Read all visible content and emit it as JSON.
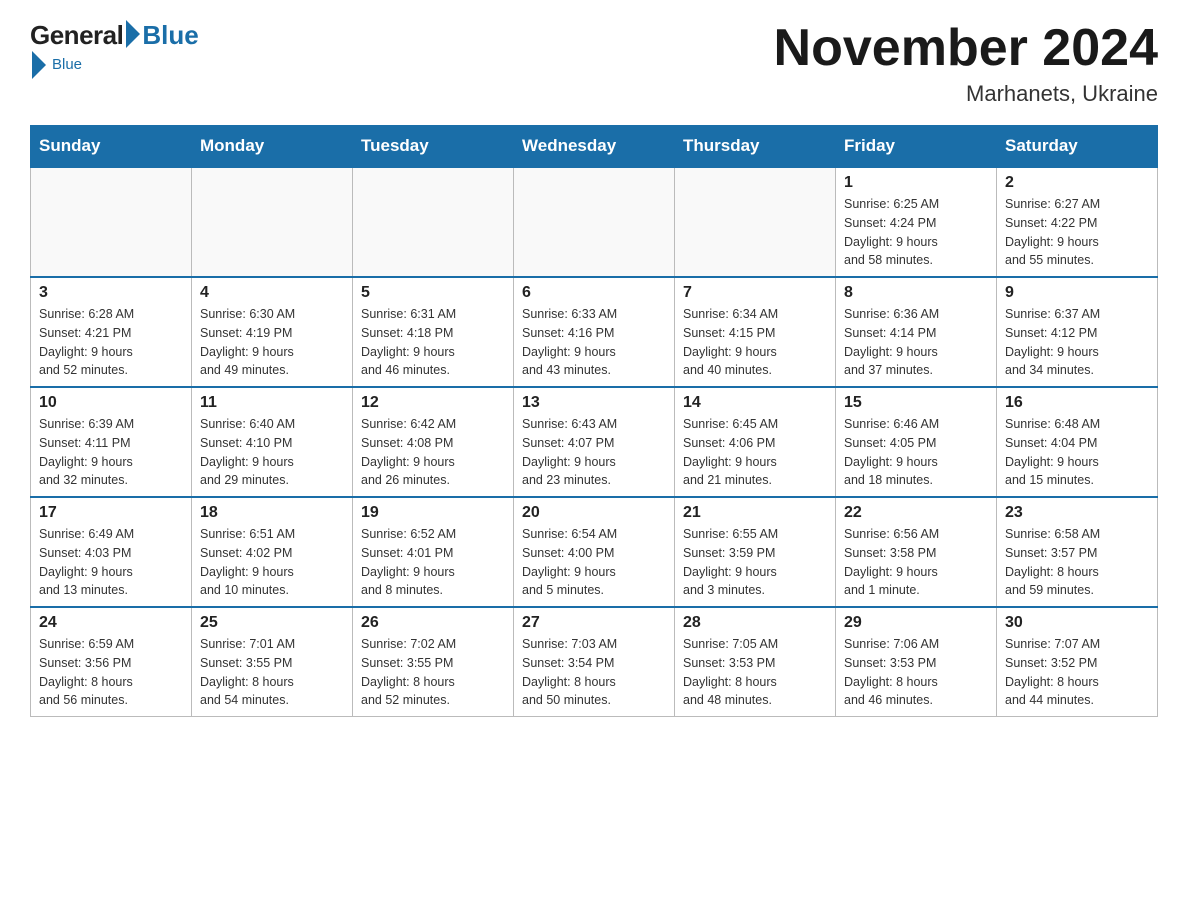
{
  "logo": {
    "general": "General",
    "blue": "Blue"
  },
  "header": {
    "month": "November 2024",
    "location": "Marhanets, Ukraine"
  },
  "weekdays": [
    "Sunday",
    "Monday",
    "Tuesday",
    "Wednesday",
    "Thursday",
    "Friday",
    "Saturday"
  ],
  "weeks": [
    [
      {
        "day": "",
        "info": ""
      },
      {
        "day": "",
        "info": ""
      },
      {
        "day": "",
        "info": ""
      },
      {
        "day": "",
        "info": ""
      },
      {
        "day": "",
        "info": ""
      },
      {
        "day": "1",
        "info": "Sunrise: 6:25 AM\nSunset: 4:24 PM\nDaylight: 9 hours\nand 58 minutes."
      },
      {
        "day": "2",
        "info": "Sunrise: 6:27 AM\nSunset: 4:22 PM\nDaylight: 9 hours\nand 55 minutes."
      }
    ],
    [
      {
        "day": "3",
        "info": "Sunrise: 6:28 AM\nSunset: 4:21 PM\nDaylight: 9 hours\nand 52 minutes."
      },
      {
        "day": "4",
        "info": "Sunrise: 6:30 AM\nSunset: 4:19 PM\nDaylight: 9 hours\nand 49 minutes."
      },
      {
        "day": "5",
        "info": "Sunrise: 6:31 AM\nSunset: 4:18 PM\nDaylight: 9 hours\nand 46 minutes."
      },
      {
        "day": "6",
        "info": "Sunrise: 6:33 AM\nSunset: 4:16 PM\nDaylight: 9 hours\nand 43 minutes."
      },
      {
        "day": "7",
        "info": "Sunrise: 6:34 AM\nSunset: 4:15 PM\nDaylight: 9 hours\nand 40 minutes."
      },
      {
        "day": "8",
        "info": "Sunrise: 6:36 AM\nSunset: 4:14 PM\nDaylight: 9 hours\nand 37 minutes."
      },
      {
        "day": "9",
        "info": "Sunrise: 6:37 AM\nSunset: 4:12 PM\nDaylight: 9 hours\nand 34 minutes."
      }
    ],
    [
      {
        "day": "10",
        "info": "Sunrise: 6:39 AM\nSunset: 4:11 PM\nDaylight: 9 hours\nand 32 minutes."
      },
      {
        "day": "11",
        "info": "Sunrise: 6:40 AM\nSunset: 4:10 PM\nDaylight: 9 hours\nand 29 minutes."
      },
      {
        "day": "12",
        "info": "Sunrise: 6:42 AM\nSunset: 4:08 PM\nDaylight: 9 hours\nand 26 minutes."
      },
      {
        "day": "13",
        "info": "Sunrise: 6:43 AM\nSunset: 4:07 PM\nDaylight: 9 hours\nand 23 minutes."
      },
      {
        "day": "14",
        "info": "Sunrise: 6:45 AM\nSunset: 4:06 PM\nDaylight: 9 hours\nand 21 minutes."
      },
      {
        "day": "15",
        "info": "Sunrise: 6:46 AM\nSunset: 4:05 PM\nDaylight: 9 hours\nand 18 minutes."
      },
      {
        "day": "16",
        "info": "Sunrise: 6:48 AM\nSunset: 4:04 PM\nDaylight: 9 hours\nand 15 minutes."
      }
    ],
    [
      {
        "day": "17",
        "info": "Sunrise: 6:49 AM\nSunset: 4:03 PM\nDaylight: 9 hours\nand 13 minutes."
      },
      {
        "day": "18",
        "info": "Sunrise: 6:51 AM\nSunset: 4:02 PM\nDaylight: 9 hours\nand 10 minutes."
      },
      {
        "day": "19",
        "info": "Sunrise: 6:52 AM\nSunset: 4:01 PM\nDaylight: 9 hours\nand 8 minutes."
      },
      {
        "day": "20",
        "info": "Sunrise: 6:54 AM\nSunset: 4:00 PM\nDaylight: 9 hours\nand 5 minutes."
      },
      {
        "day": "21",
        "info": "Sunrise: 6:55 AM\nSunset: 3:59 PM\nDaylight: 9 hours\nand 3 minutes."
      },
      {
        "day": "22",
        "info": "Sunrise: 6:56 AM\nSunset: 3:58 PM\nDaylight: 9 hours\nand 1 minute."
      },
      {
        "day": "23",
        "info": "Sunrise: 6:58 AM\nSunset: 3:57 PM\nDaylight: 8 hours\nand 59 minutes."
      }
    ],
    [
      {
        "day": "24",
        "info": "Sunrise: 6:59 AM\nSunset: 3:56 PM\nDaylight: 8 hours\nand 56 minutes."
      },
      {
        "day": "25",
        "info": "Sunrise: 7:01 AM\nSunset: 3:55 PM\nDaylight: 8 hours\nand 54 minutes."
      },
      {
        "day": "26",
        "info": "Sunrise: 7:02 AM\nSunset: 3:55 PM\nDaylight: 8 hours\nand 52 minutes."
      },
      {
        "day": "27",
        "info": "Sunrise: 7:03 AM\nSunset: 3:54 PM\nDaylight: 8 hours\nand 50 minutes."
      },
      {
        "day": "28",
        "info": "Sunrise: 7:05 AM\nSunset: 3:53 PM\nDaylight: 8 hours\nand 48 minutes."
      },
      {
        "day": "29",
        "info": "Sunrise: 7:06 AM\nSunset: 3:53 PM\nDaylight: 8 hours\nand 46 minutes."
      },
      {
        "day": "30",
        "info": "Sunrise: 7:07 AM\nSunset: 3:52 PM\nDaylight: 8 hours\nand 44 minutes."
      }
    ]
  ]
}
